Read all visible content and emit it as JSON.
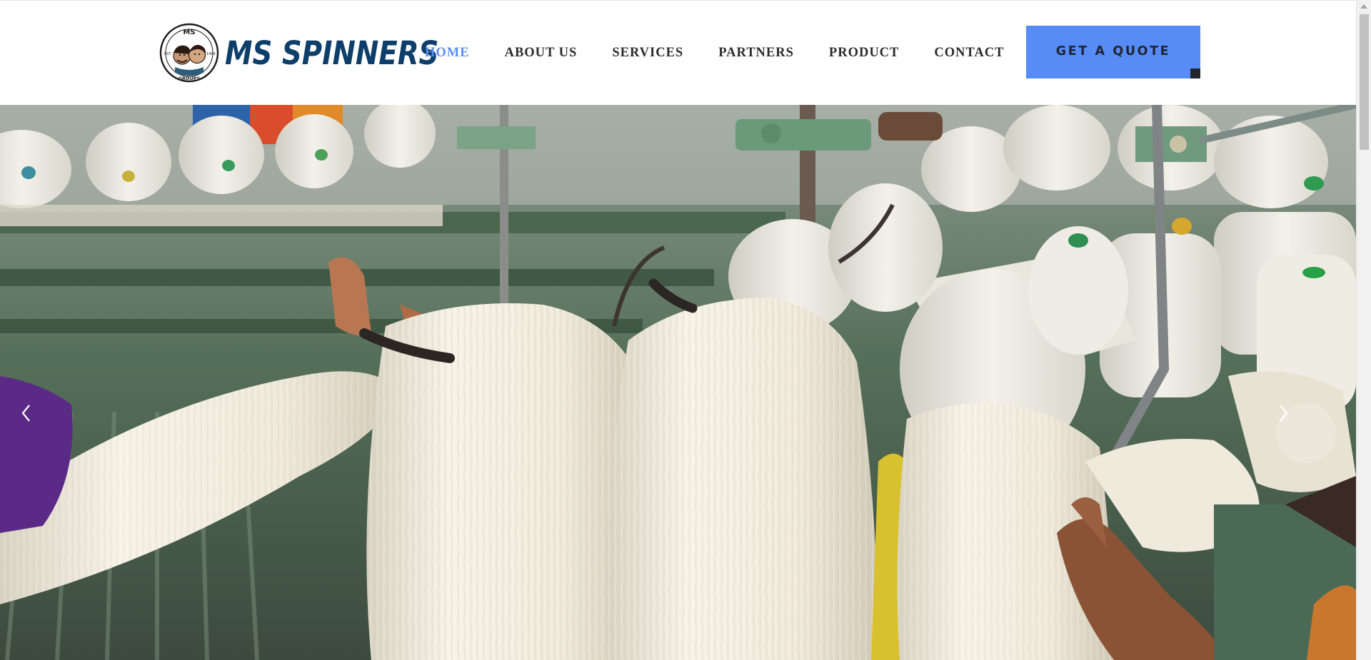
{
  "brand": {
    "name": "MS SPINNERS",
    "seal_top": "MS",
    "seal_bottom": "GROUPS",
    "seal_left": "EST.",
    "seal_right": "1964",
    "color": "#0e3e6a"
  },
  "nav": {
    "items": [
      {
        "label": "HOME",
        "active": true
      },
      {
        "label": "ABOUT US",
        "active": false
      },
      {
        "label": "SERVICES",
        "active": false
      },
      {
        "label": "PARTNERS",
        "active": false
      },
      {
        "label": "PRODUCT",
        "active": false
      },
      {
        "label": "CONTACT",
        "active": false
      }
    ],
    "active_color": "#5b8ff5"
  },
  "cta": {
    "label": "GET A QUOTE",
    "color": "#578cf7"
  },
  "hero": {
    "image": "spinning-mill-yarn-hanks-photo",
    "prev_icon": "chevron-left-icon",
    "next_icon": "chevron-right-icon"
  }
}
